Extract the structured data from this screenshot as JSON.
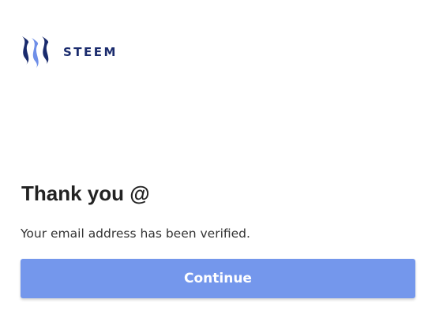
{
  "brand": {
    "name": "STEEM",
    "logo_icon": "steem-logo-icon",
    "color": "#1a2b6d"
  },
  "main": {
    "title": "Thank you @",
    "message": "Your email address has been verified.",
    "continue_label": "Continue"
  },
  "colors": {
    "button_bg": "#7497ec",
    "button_text": "#ffffff",
    "title_text": "#222222",
    "body_text": "#333333"
  }
}
